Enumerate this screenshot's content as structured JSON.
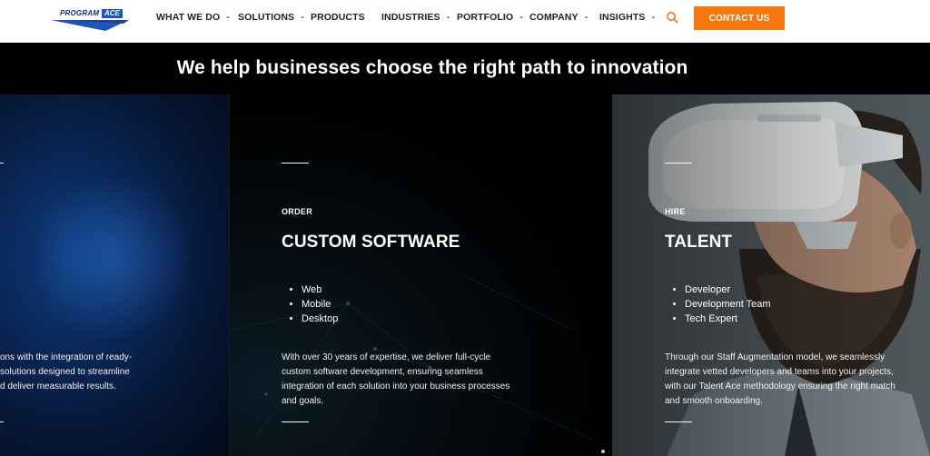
{
  "header": {
    "logo": {
      "text": "PROGRAM",
      "ace": "ACE"
    },
    "nav": [
      {
        "label": "WHAT WE DO",
        "has_dropdown": true
      },
      {
        "label": "SOLUTIONS",
        "has_dropdown": true
      },
      {
        "label": "PRODUCTS",
        "has_dropdown": false
      },
      {
        "label": "INDUSTRIES",
        "has_dropdown": true
      },
      {
        "label": "PORTFOLIO",
        "has_dropdown": true
      },
      {
        "label": "COMPANY",
        "has_dropdown": true
      },
      {
        "label": "INSIGHTS",
        "has_dropdown": true
      }
    ],
    "search_icon": "search-icon",
    "contact_label": "CONTACT US"
  },
  "hero": {
    "title": "We help businesses choose the right path to innovation"
  },
  "cards": [
    {
      "text_lines": [
        "ons with the integration of ready-",
        "solutions designed to streamline",
        "d deliver measurable results."
      ]
    },
    {
      "eyebrow": "ORDER",
      "title": "CUSTOM SOFTWARE",
      "items": [
        "Web",
        "Mobile",
        "Desktop"
      ],
      "text_lines": [
        "With over 30 years of expertise, we deliver full-cycle",
        "custom software development, ensuring seamless",
        "integration of each solution into your business processes",
        "and goals."
      ]
    },
    {
      "eyebrow": "HIRE",
      "title": "TALENT",
      "items": [
        "Developer",
        "Development Team",
        "Tech Expert"
      ],
      "text_lines": [
        "Through our Staff Augmentation model, we seamlessly",
        "integrate vetted developers and teams into your projects,",
        "with our Talent Ace methodology ensuring the right match",
        "and smooth onboarding."
      ]
    }
  ],
  "colors": {
    "accent": "#f7770f",
    "brand_blue": "#1e56b8"
  }
}
